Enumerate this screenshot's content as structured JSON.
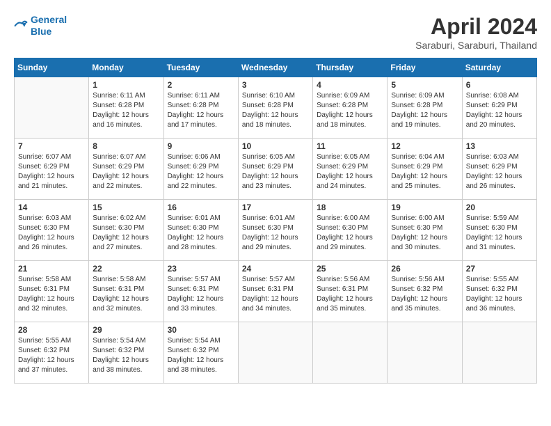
{
  "header": {
    "logo_line1": "General",
    "logo_line2": "Blue",
    "month_title": "April 2024",
    "location": "Saraburi, Saraburi, Thailand"
  },
  "days_of_week": [
    "Sunday",
    "Monday",
    "Tuesday",
    "Wednesday",
    "Thursday",
    "Friday",
    "Saturday"
  ],
  "weeks": [
    [
      {
        "day": null
      },
      {
        "day": 1,
        "sunrise": "6:11 AM",
        "sunset": "6:28 PM",
        "daylight": "12 hours and 16 minutes."
      },
      {
        "day": 2,
        "sunrise": "6:11 AM",
        "sunset": "6:28 PM",
        "daylight": "12 hours and 17 minutes."
      },
      {
        "day": 3,
        "sunrise": "6:10 AM",
        "sunset": "6:28 PM",
        "daylight": "12 hours and 18 minutes."
      },
      {
        "day": 4,
        "sunrise": "6:09 AM",
        "sunset": "6:28 PM",
        "daylight": "12 hours and 18 minutes."
      },
      {
        "day": 5,
        "sunrise": "6:09 AM",
        "sunset": "6:28 PM",
        "daylight": "12 hours and 19 minutes."
      },
      {
        "day": 6,
        "sunrise": "6:08 AM",
        "sunset": "6:29 PM",
        "daylight": "12 hours and 20 minutes."
      }
    ],
    [
      {
        "day": 7,
        "sunrise": "6:07 AM",
        "sunset": "6:29 PM",
        "daylight": "12 hours and 21 minutes."
      },
      {
        "day": 8,
        "sunrise": "6:07 AM",
        "sunset": "6:29 PM",
        "daylight": "12 hours and 22 minutes."
      },
      {
        "day": 9,
        "sunrise": "6:06 AM",
        "sunset": "6:29 PM",
        "daylight": "12 hours and 22 minutes."
      },
      {
        "day": 10,
        "sunrise": "6:05 AM",
        "sunset": "6:29 PM",
        "daylight": "12 hours and 23 minutes."
      },
      {
        "day": 11,
        "sunrise": "6:05 AM",
        "sunset": "6:29 PM",
        "daylight": "12 hours and 24 minutes."
      },
      {
        "day": 12,
        "sunrise": "6:04 AM",
        "sunset": "6:29 PM",
        "daylight": "12 hours and 25 minutes."
      },
      {
        "day": 13,
        "sunrise": "6:03 AM",
        "sunset": "6:29 PM",
        "daylight": "12 hours and 26 minutes."
      }
    ],
    [
      {
        "day": 14,
        "sunrise": "6:03 AM",
        "sunset": "6:30 PM",
        "daylight": "12 hours and 26 minutes."
      },
      {
        "day": 15,
        "sunrise": "6:02 AM",
        "sunset": "6:30 PM",
        "daylight": "12 hours and 27 minutes."
      },
      {
        "day": 16,
        "sunrise": "6:01 AM",
        "sunset": "6:30 PM",
        "daylight": "12 hours and 28 minutes."
      },
      {
        "day": 17,
        "sunrise": "6:01 AM",
        "sunset": "6:30 PM",
        "daylight": "12 hours and 29 minutes."
      },
      {
        "day": 18,
        "sunrise": "6:00 AM",
        "sunset": "6:30 PM",
        "daylight": "12 hours and 29 minutes."
      },
      {
        "day": 19,
        "sunrise": "6:00 AM",
        "sunset": "6:30 PM",
        "daylight": "12 hours and 30 minutes."
      },
      {
        "day": 20,
        "sunrise": "5:59 AM",
        "sunset": "6:30 PM",
        "daylight": "12 hours and 31 minutes."
      }
    ],
    [
      {
        "day": 21,
        "sunrise": "5:58 AM",
        "sunset": "6:31 PM",
        "daylight": "12 hours and 32 minutes."
      },
      {
        "day": 22,
        "sunrise": "5:58 AM",
        "sunset": "6:31 PM",
        "daylight": "12 hours and 32 minutes."
      },
      {
        "day": 23,
        "sunrise": "5:57 AM",
        "sunset": "6:31 PM",
        "daylight": "12 hours and 33 minutes."
      },
      {
        "day": 24,
        "sunrise": "5:57 AM",
        "sunset": "6:31 PM",
        "daylight": "12 hours and 34 minutes."
      },
      {
        "day": 25,
        "sunrise": "5:56 AM",
        "sunset": "6:31 PM",
        "daylight": "12 hours and 35 minutes."
      },
      {
        "day": 26,
        "sunrise": "5:56 AM",
        "sunset": "6:32 PM",
        "daylight": "12 hours and 35 minutes."
      },
      {
        "day": 27,
        "sunrise": "5:55 AM",
        "sunset": "6:32 PM",
        "daylight": "12 hours and 36 minutes."
      }
    ],
    [
      {
        "day": 28,
        "sunrise": "5:55 AM",
        "sunset": "6:32 PM",
        "daylight": "12 hours and 37 minutes."
      },
      {
        "day": 29,
        "sunrise": "5:54 AM",
        "sunset": "6:32 PM",
        "daylight": "12 hours and 38 minutes."
      },
      {
        "day": 30,
        "sunrise": "5:54 AM",
        "sunset": "6:32 PM",
        "daylight": "12 hours and 38 minutes."
      },
      {
        "day": null
      },
      {
        "day": null
      },
      {
        "day": null
      },
      {
        "day": null
      }
    ]
  ]
}
